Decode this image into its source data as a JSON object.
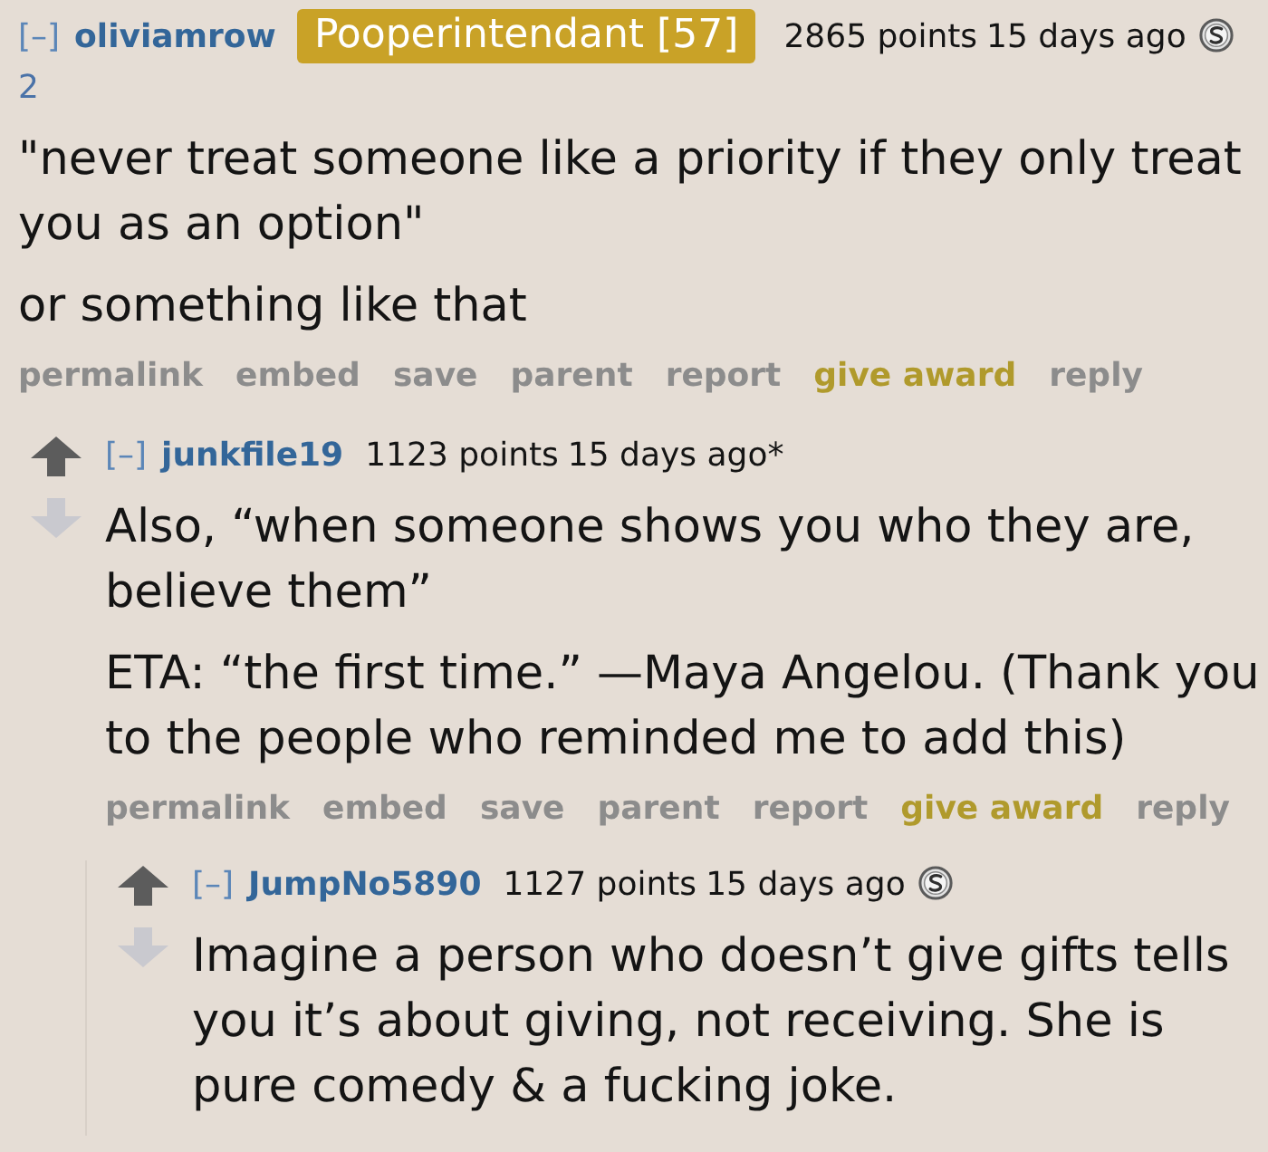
{
  "comments": [
    {
      "toggle": "[–]",
      "author": "oliviamrow",
      "flair": "Pooperintendant [57]",
      "score": "2865 points",
      "time": "15 days ago",
      "awards": [
        {
          "kind": "silver",
          "count": "2"
        }
      ],
      "paragraphs": [
        "\"never treat someone like a priority if they only treat you as an option\"",
        "or something like that"
      ],
      "actions": [
        {
          "label": "permalink",
          "kind": "link"
        },
        {
          "label": "embed",
          "kind": "link"
        },
        {
          "label": "save",
          "kind": "link"
        },
        {
          "label": "parent",
          "kind": "link"
        },
        {
          "label": "report",
          "kind": "link"
        },
        {
          "label": "give award",
          "kind": "award"
        },
        {
          "label": "reply",
          "kind": "link"
        }
      ],
      "replies": [
        {
          "toggle": "[–]",
          "author": "junkfile19",
          "score": "1123 points",
          "time": "15 days ago*",
          "paragraphs": [
            "Also, “when someone shows you who they are, believe them”",
            "ETA: “the first time.” —Maya Angelou. (Thank you to the people who reminded me to add this)"
          ],
          "actions": [
            {
              "label": "permalink",
              "kind": "link"
            },
            {
              "label": "embed",
              "kind": "link"
            },
            {
              "label": "save",
              "kind": "link"
            },
            {
              "label": "parent",
              "kind": "link"
            },
            {
              "label": "report",
              "kind": "link"
            },
            {
              "label": "give award",
              "kind": "award"
            },
            {
              "label": "reply",
              "kind": "link"
            }
          ],
          "replies": [
            {
              "toggle": "[–]",
              "author": "JumpNo5890",
              "score": "1127 points",
              "time": "15 days ago",
              "awards": [
                {
                  "kind": "silver"
                }
              ],
              "paragraphs": [
                "Imagine a person who doesn’t give gifts tells you it’s about giving, not receiving. She is pure comedy & a fucking joke."
              ]
            }
          ]
        }
      ]
    }
  ]
}
